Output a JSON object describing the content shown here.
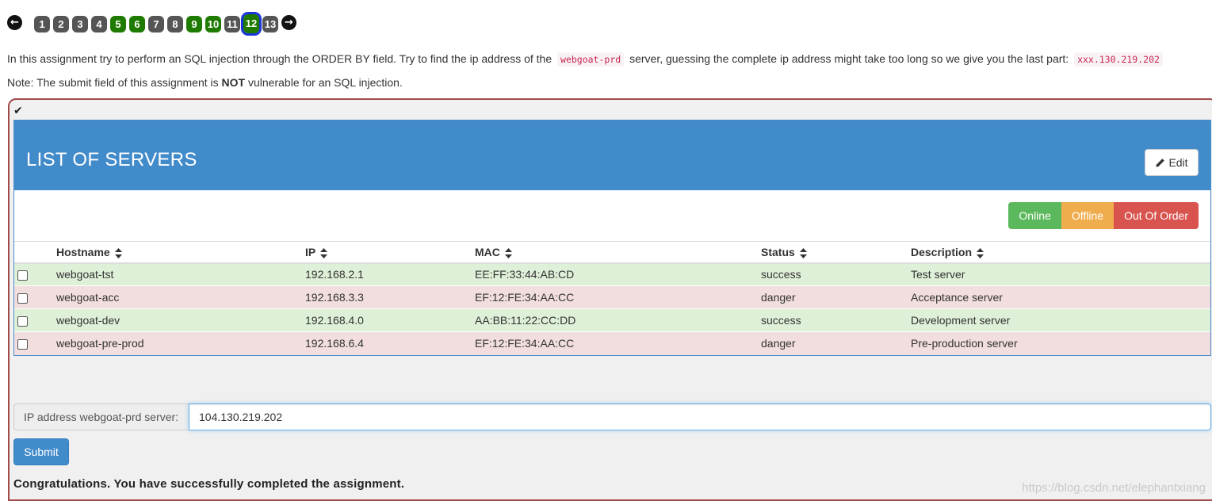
{
  "pagination": {
    "prev_icon": "arrow-left-circle-icon",
    "next_icon": "arrow-right-circle-icon",
    "pages": [
      {
        "label": "1",
        "state": "default"
      },
      {
        "label": "2",
        "state": "default"
      },
      {
        "label": "3",
        "state": "default"
      },
      {
        "label": "4",
        "state": "default"
      },
      {
        "label": "5",
        "state": "done"
      },
      {
        "label": "6",
        "state": "done"
      },
      {
        "label": "7",
        "state": "default"
      },
      {
        "label": "8",
        "state": "default"
      },
      {
        "label": "9",
        "state": "done"
      },
      {
        "label": "10",
        "state": "done"
      },
      {
        "label": "11",
        "state": "default"
      },
      {
        "label": "12",
        "state": "active"
      },
      {
        "label": "13",
        "state": "default"
      }
    ]
  },
  "intro": {
    "part1": "In this assignment try to perform an SQL injection through the ORDER BY field. Try to find the ip address of the",
    "code1": "webgoat-prd",
    "part2": "server, guessing the complete ip address might take too long so we give you the last part:",
    "code2": "xxx.130.219.202"
  },
  "note": {
    "prefix": "Note: The submit field of this assignment is",
    "emphasis": "NOT",
    "suffix": "vulnerable for an SQL injection."
  },
  "panel": {
    "status_icon": "checkmark-icon",
    "title": "LIST OF SERVERS",
    "edit_label": "Edit",
    "edit_icon": "pencil-icon",
    "legend": {
      "online": "Online",
      "offline": "Offline",
      "out_of_order": "Out Of Order"
    },
    "columns": [
      "Hostname",
      "IP",
      "MAC",
      "Status",
      "Description"
    ],
    "rows": [
      {
        "hostname": "webgoat-tst",
        "ip": "192.168.2.1",
        "mac": "EE:FF:33:44:AB:CD",
        "status": "success",
        "description": "Test server"
      },
      {
        "hostname": "webgoat-acc",
        "ip": "192.168.3.3",
        "mac": "EF:12:FE:34:AA:CC",
        "status": "danger",
        "description": "Acceptance server"
      },
      {
        "hostname": "webgoat-dev",
        "ip": "192.168.4.0",
        "mac": "AA:BB:11:22:CC:DD",
        "status": "success",
        "description": "Development server"
      },
      {
        "hostname": "webgoat-pre-prod",
        "ip": "192.168.6.4",
        "mac": "EF:12:FE:34:AA:CC",
        "status": "danger",
        "description": "Pre-production server"
      }
    ]
  },
  "form": {
    "label": "IP address webgoat-prd server:",
    "value": "104.130.219.202",
    "submit_label": "Submit"
  },
  "feedback": "Congratulations. You have successfully completed the assignment.",
  "watermark": "https://blog.csdn.net/elephantxiang",
  "colors": {
    "primary": "#428bca",
    "success_row": "#dff0d8",
    "danger_row": "#f2dede",
    "online": "#5cb85c",
    "offline": "#f0ad4e",
    "out_of_order": "#d9534f",
    "page_done": "#1e7b00",
    "page_default": "#555555"
  }
}
